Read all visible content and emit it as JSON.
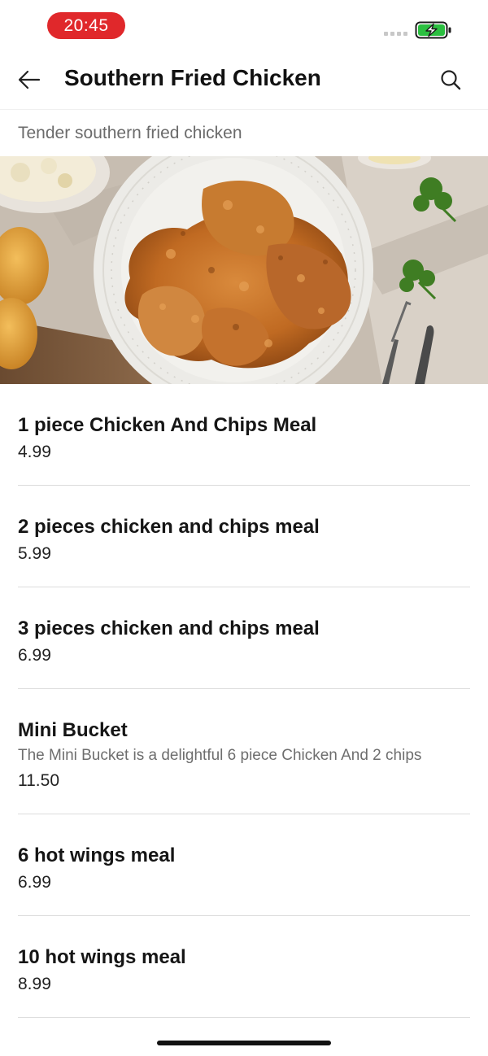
{
  "status_bar": {
    "time": "20:45",
    "time_pill_color": "#e0282b",
    "battery_color": "#2bbf40",
    "battery_state": "charging"
  },
  "header": {
    "title": "Southern Fried Chicken",
    "back_icon": "arrow-left-icon",
    "search_icon": "search-icon"
  },
  "category": {
    "description": "Tender southern fried chicken",
    "hero_image": "fried-chicken-plate"
  },
  "menu": {
    "items": [
      {
        "name": "1 piece Chicken And Chips Meal",
        "description": "",
        "price": "4.99"
      },
      {
        "name": "2 pieces chicken and chips meal",
        "description": "",
        "price": "5.99"
      },
      {
        "name": "3 pieces chicken and chips meal",
        "description": "",
        "price": "6.99"
      },
      {
        "name": "Mini Bucket",
        "description": "The Mini Bucket is a delightful 6 piece Chicken And 2 chips",
        "price": "11.50"
      },
      {
        "name": "6 hot wings meal",
        "description": "",
        "price": "6.99"
      },
      {
        "name": "10 hot wings meal",
        "description": "",
        "price": "8.99"
      }
    ]
  }
}
